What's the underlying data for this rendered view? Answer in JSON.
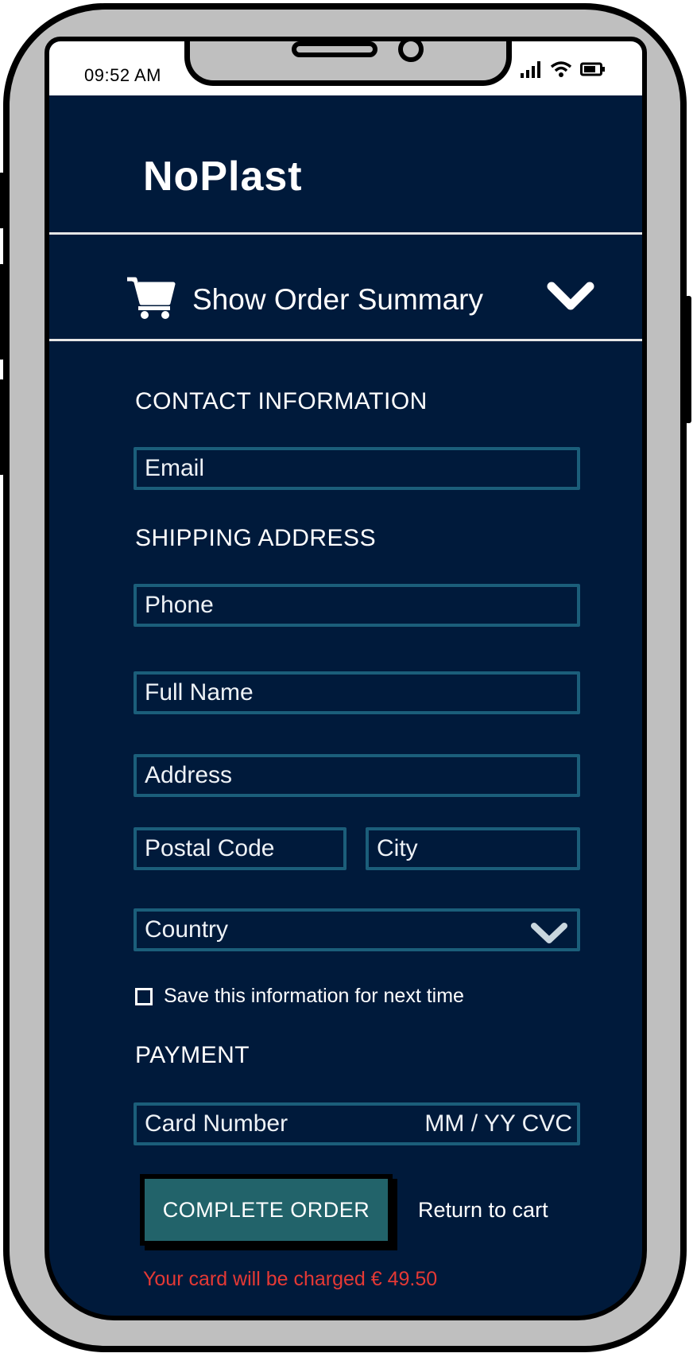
{
  "status_bar": {
    "time": "09:52 AM"
  },
  "header": {
    "brand": "NoPlast"
  },
  "order_summary": {
    "label": "Show Order Summary"
  },
  "contact": {
    "title": "CONTACT INFORMATION",
    "email_placeholder": "Email"
  },
  "shipping": {
    "title": "SHIPPING ADDRESS",
    "phone_placeholder": "Phone",
    "full_name_placeholder": "Full Name",
    "address_placeholder": "Address",
    "postal_code_placeholder": "Postal Code",
    "city_placeholder": "City",
    "country_label": "Country",
    "save_info_label": "Save this information for next time"
  },
  "payment": {
    "title": "PAYMENT",
    "card_number_placeholder": "Card Number",
    "expiry_cvc_label": "MM / YY CVC"
  },
  "actions": {
    "complete_order": "COMPLETE ORDER",
    "return_to_cart": "Return to cart",
    "charge_note": "Your card will be charged € 49.50"
  },
  "colors": {
    "background": "#001a3b",
    "field_border": "#1b5e7a",
    "button": "#22636a",
    "charge_text": "#e53935"
  },
  "icons": {
    "cart": "cart-icon",
    "chevron": "chevron-down-icon",
    "signal": "signal-icon",
    "wifi": "wifi-icon",
    "battery": "battery-icon"
  }
}
